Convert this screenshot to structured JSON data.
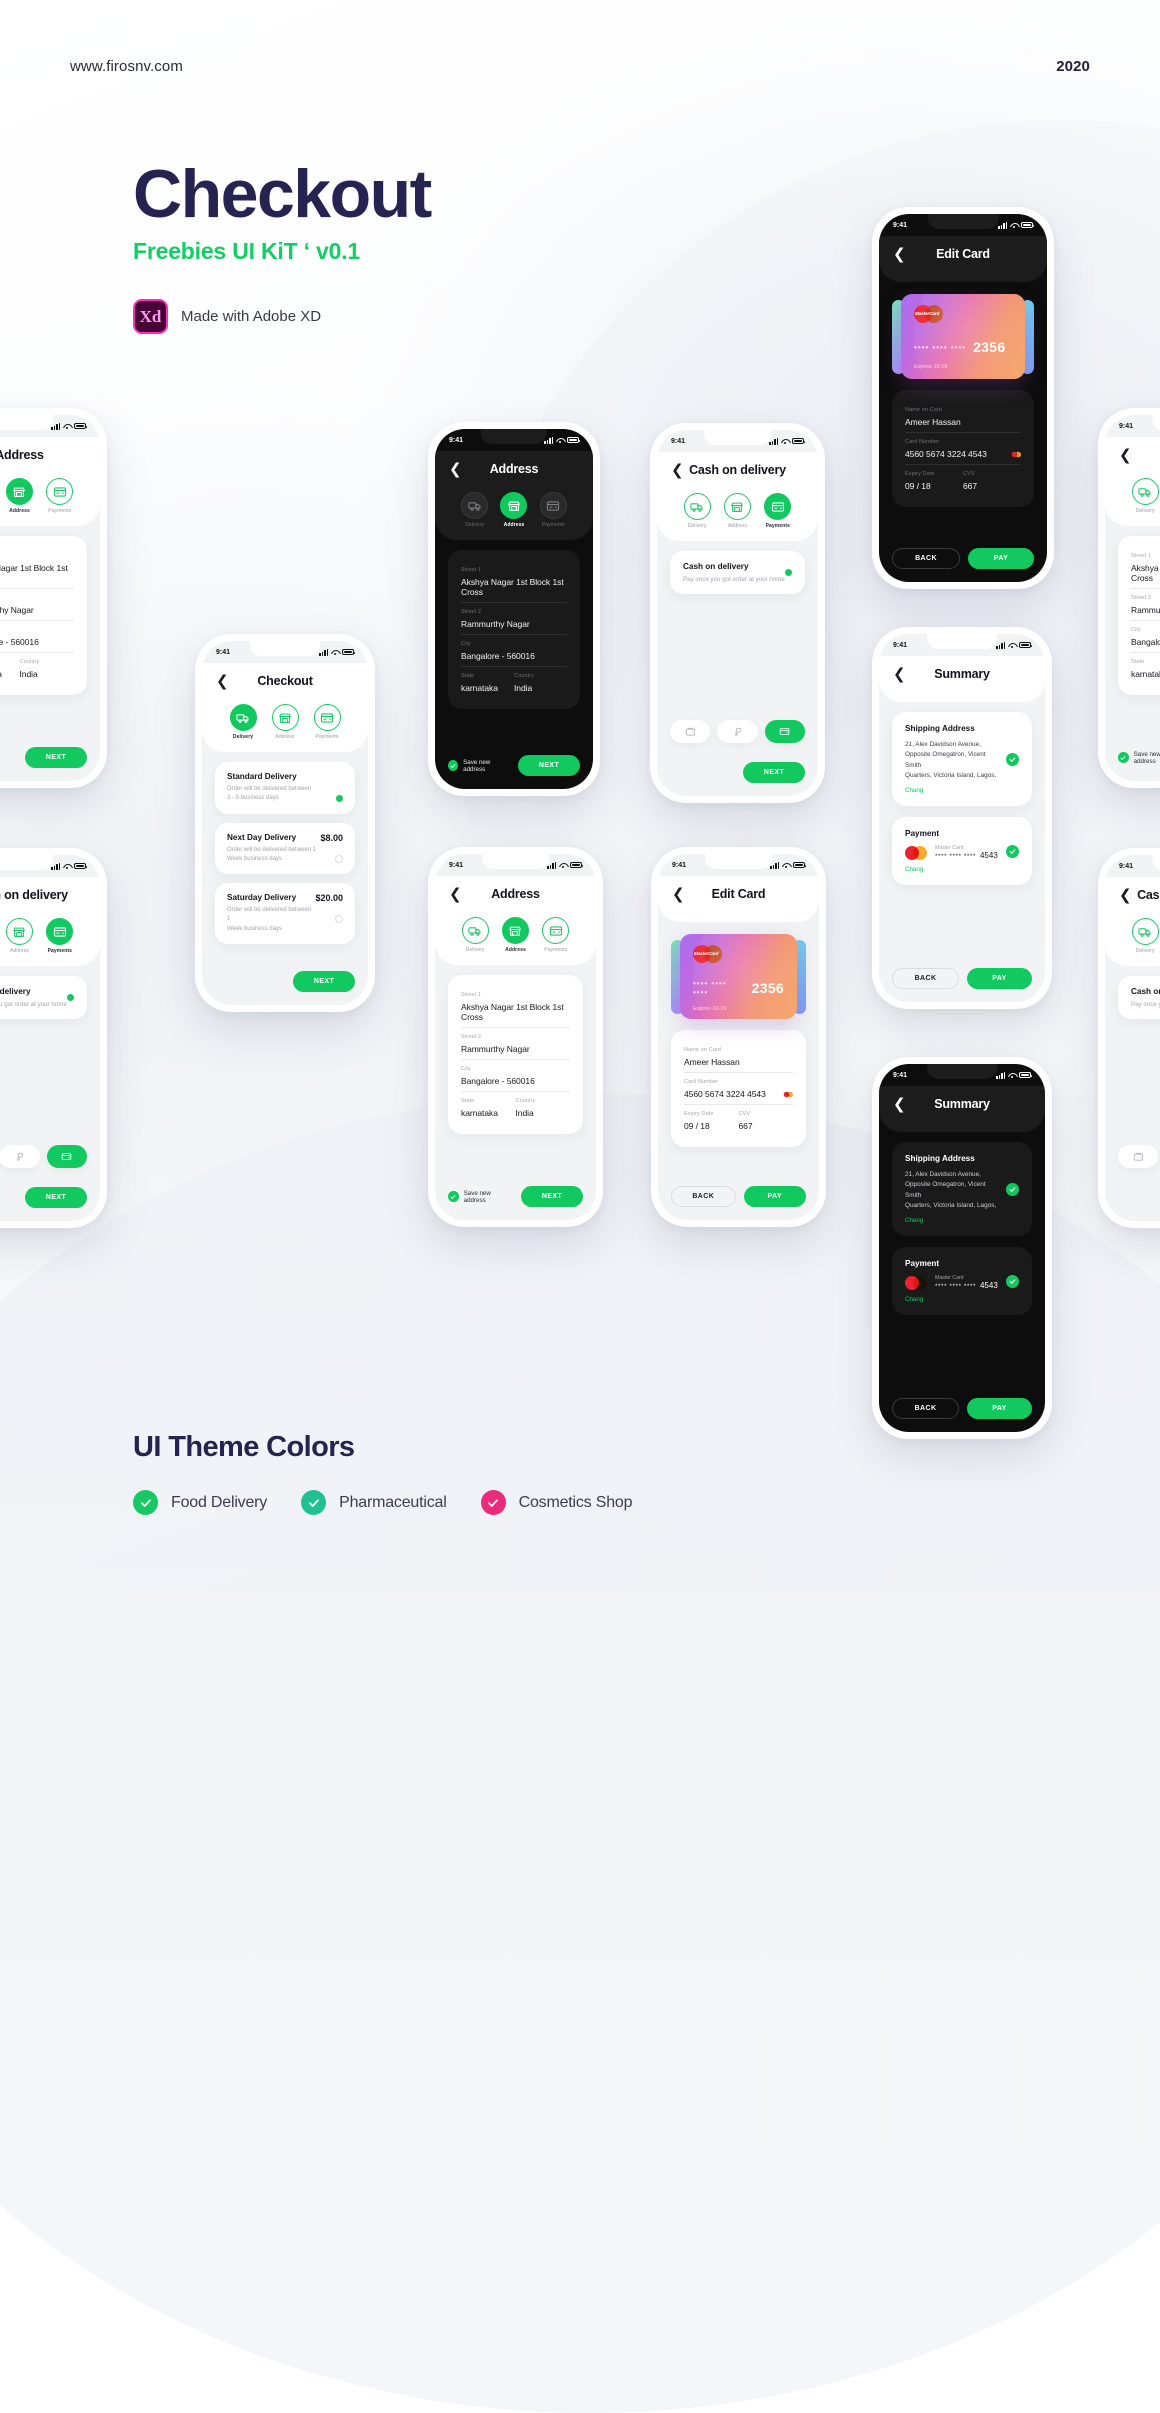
{
  "header": {
    "site": "www.firosnv.com",
    "year": "2020"
  },
  "title": {
    "main": "Checkout",
    "sub": "Freebies UI KiT ‘ v0.1",
    "xd_badge": "Xd",
    "xd_label": "Made with Adobe XD"
  },
  "status": {
    "time": "9:41"
  },
  "steps": {
    "delivery": "Delivery",
    "address": "Address",
    "payments": "Payments"
  },
  "buttons": {
    "next": "NEXT",
    "back": "BACK",
    "pay": "PAY"
  },
  "address_screen": {
    "title": "Address",
    "fields": [
      {
        "label": "Street 1",
        "value": "Akshya Nagar 1st Block 1st Cross"
      },
      {
        "label": "Street 2",
        "value": "Rammurthy Nagar"
      },
      {
        "label": "City",
        "value": "Bangalore - 560016"
      }
    ],
    "state": {
      "label": "State",
      "value": "karnataka"
    },
    "country": {
      "label": "Country",
      "value": "India"
    },
    "save_label": "Save new address"
  },
  "checkout_screen": {
    "title": "Checkout",
    "options": [
      {
        "name": "Standard Delivery",
        "price": "",
        "desc1": "Order will be delivered between",
        "desc2": "3 - 5 business days",
        "selected": true
      },
      {
        "name": "Next Day Delivery",
        "price": "$8.00",
        "desc1": "Order will be delivered between 1",
        "desc2": "Week business days",
        "selected": false
      },
      {
        "name": "Saturday Delivery",
        "price": "$20.00",
        "desc1": "Order will be delivered between 1",
        "desc2": "Week business days",
        "selected": false
      }
    ]
  },
  "cod_screen": {
    "title": "Cash on delivery",
    "card_title": "Cash on delivery",
    "card_desc": "Pay once you got order at your home",
    "methods": [
      "wallet-icon",
      "paypal-icon",
      "card-icon"
    ]
  },
  "editcard_screen": {
    "title": "Edit Card",
    "card": {
      "brand": "MasterCard",
      "dots": "••••  ••••  ••••",
      "last4": "2356",
      "expires": "Expires 10-19"
    },
    "fields": {
      "name_label": "Name on Card",
      "name_value": "Ameer Hassan",
      "number_label": "Card Number",
      "number_value": "4560  5674  3224  4543",
      "expiry_label": "Expiry Date",
      "expiry_value": "09 / 18",
      "cvv_label": "CVV",
      "cvv_value": "667"
    }
  },
  "summary_screen": {
    "title": "Summary",
    "shipping": {
      "heading": "Shipping Address",
      "line1": "21, Alex Davidson Avenue,",
      "line2": "Opposite Omegatron, Vicent Smith",
      "line3": "Quarters, Victoria Island, Lagos,",
      "change": "Chang"
    },
    "payment": {
      "heading": "Payment",
      "brand": "Master Card",
      "masked": "****  ****  ****",
      "last4": "4543",
      "change": "Chang"
    }
  },
  "theme": {
    "title": "UI Theme Colors",
    "items": [
      {
        "label": "Food Delivery",
        "color": "#17c964"
      },
      {
        "label": "Pharmaceutical",
        "color": "#21c093"
      },
      {
        "label": "Cosmetics Shop",
        "color": "#ea2a7b"
      }
    ]
  },
  "colors": {
    "accent_green": "#11c95f",
    "navy": "#252350",
    "dark_bg": "#0d0d0d"
  }
}
